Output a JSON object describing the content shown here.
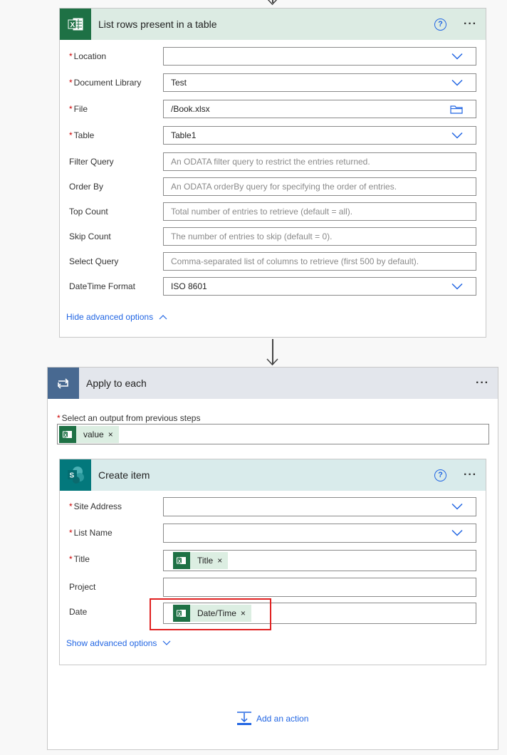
{
  "list_rows": {
    "title": "List rows present in a table",
    "help": "?",
    "more": "···",
    "fields": [
      {
        "label": "Location",
        "required": true,
        "value": "",
        "placeholder": "",
        "control": "dropdown"
      },
      {
        "label": "Document Library",
        "required": true,
        "value": "Test",
        "placeholder": "",
        "control": "dropdown"
      },
      {
        "label": "File",
        "required": true,
        "value": "/Book.xlsx",
        "placeholder": "",
        "control": "folder"
      },
      {
        "label": "Table",
        "required": true,
        "value": "Table1",
        "placeholder": "",
        "control": "dropdown"
      },
      {
        "label": "Filter Query",
        "required": false,
        "value": "",
        "placeholder": "An ODATA filter query to restrict the entries returned.",
        "control": "text"
      },
      {
        "label": "Order By",
        "required": false,
        "value": "",
        "placeholder": "An ODATA orderBy query for specifying the order of entries.",
        "control": "text"
      },
      {
        "label": "Top Count",
        "required": false,
        "value": "",
        "placeholder": "Total number of entries to retrieve (default = all).",
        "control": "text"
      },
      {
        "label": "Skip Count",
        "required": false,
        "value": "",
        "placeholder": "The number of entries to skip (default = 0).",
        "control": "text"
      },
      {
        "label": "Select Query",
        "required": false,
        "value": "",
        "placeholder": "Comma-separated list of columns to retrieve (first 500 by default).",
        "control": "text"
      },
      {
        "label": "DateTime Format",
        "required": false,
        "value": "ISO 8601",
        "placeholder": "",
        "control": "dropdown"
      }
    ],
    "advanced_link": "Hide advanced options"
  },
  "apply_each": {
    "title": "Apply to each",
    "more": "···",
    "select_label": "Select an output from previous steps",
    "token": "value"
  },
  "create_item": {
    "title": "Create item",
    "help": "?",
    "more": "···",
    "fields": [
      {
        "label": "Site Address",
        "required": true,
        "control": "dropdown",
        "token": ""
      },
      {
        "label": "List Name",
        "required": true,
        "control": "dropdown",
        "token": ""
      },
      {
        "label": "Title",
        "required": true,
        "control": "token",
        "token": "Title"
      },
      {
        "label": "Project",
        "required": false,
        "control": "text",
        "token": ""
      },
      {
        "label": "Date",
        "required": false,
        "control": "token",
        "token": "Date/Time"
      }
    ],
    "advanced_link": "Show advanced options"
  },
  "add_action": "Add an action",
  "colors": {
    "excel": "#1e7145",
    "sharepoint": "#03787c",
    "loop": "#486991",
    "link": "#2266e3",
    "highlight": "#e02020"
  }
}
